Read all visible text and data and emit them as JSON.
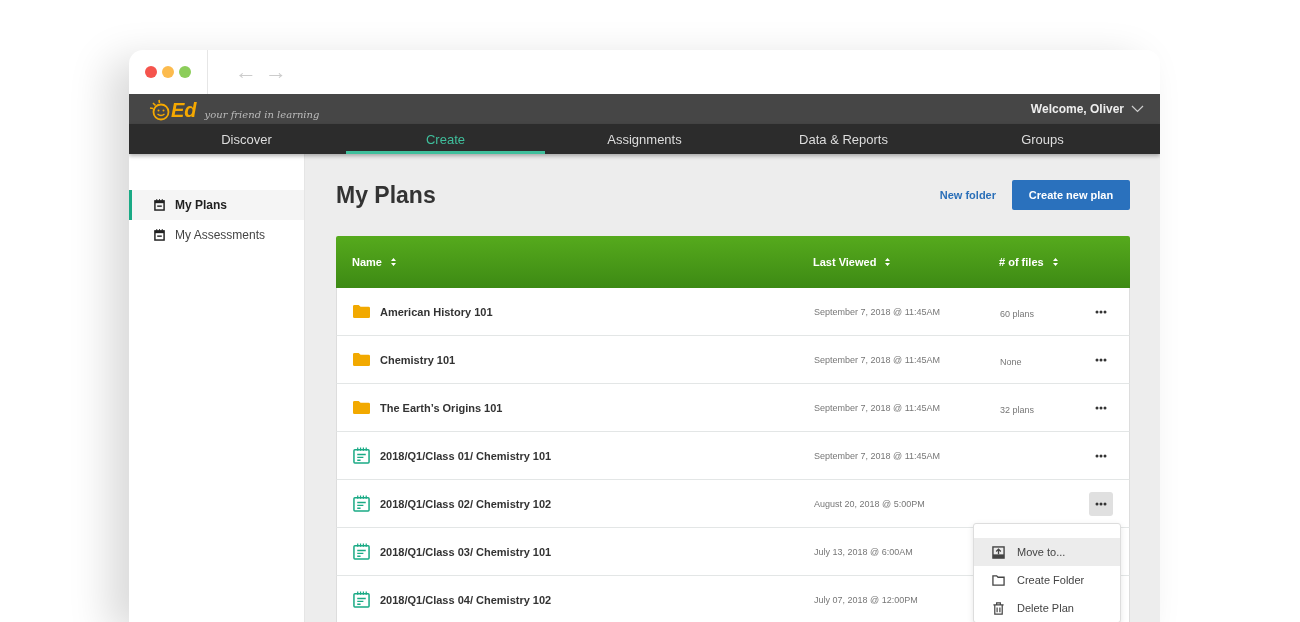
{
  "browser": {
    "arrows": [
      "←",
      "→"
    ]
  },
  "header": {
    "logo": "Ed",
    "tagline": "your friend in learning",
    "welcome": "Welcome, Oliver"
  },
  "nav": [
    {
      "label": "Discover",
      "selected": false
    },
    {
      "label": "Create",
      "selected": true
    },
    {
      "label": "Assignments",
      "selected": false
    },
    {
      "label": "Data & Reports",
      "selected": false
    },
    {
      "label": "Groups",
      "selected": false
    }
  ],
  "sidebar": {
    "items": [
      {
        "label": "My Plans",
        "selected": true
      },
      {
        "label": "My Assessments",
        "selected": false
      }
    ]
  },
  "page": {
    "title": "My Plans",
    "new_folder": "New folder",
    "create_button": "Create new plan"
  },
  "table": {
    "columns": [
      "Name",
      "Last Viewed",
      "# of files"
    ],
    "rows": [
      {
        "kind": "folder",
        "name": "American History 101",
        "last_viewed": "September 7, 2018 @ 11:45AM",
        "files": "60 plans",
        "menu_open": false
      },
      {
        "kind": "folder",
        "name": "Chemistry 101",
        "last_viewed": "September 7, 2018 @ 11:45AM",
        "files": "None",
        "menu_open": false
      },
      {
        "kind": "folder",
        "name": "The Earth’s Origins 101",
        "last_viewed": "September 7, 2018 @ 11:45AM",
        "files": "32 plans",
        "menu_open": false
      },
      {
        "kind": "plan",
        "name": "2018/Q1/Class 01/ Chemistry 101",
        "last_viewed": "September 7, 2018 @ 11:45AM",
        "menu_open": false
      },
      {
        "kind": "plan",
        "name": "2018/Q1/Class 02/ Chemistry 102",
        "last_viewed": "August 20, 2018 @ 5:00PM",
        "menu_open": true
      },
      {
        "kind": "plan",
        "name": "2018/Q1/Class 03/ Chemistry 101",
        "last_viewed": "July 13, 2018 @ 6:00AM"
      },
      {
        "kind": "plan",
        "name": "2018/Q1/Class 04/ Chemistry 102",
        "last_viewed": "July 07, 2018 @ 12:00PM"
      }
    ]
  },
  "menu": [
    {
      "kind": "move",
      "label": "Move to...",
      "selected": true
    },
    {
      "kind": "folder",
      "label": "Create Folder",
      "selected": false
    },
    {
      "kind": "delete",
      "label": "Delete Plan",
      "selected": false
    }
  ]
}
